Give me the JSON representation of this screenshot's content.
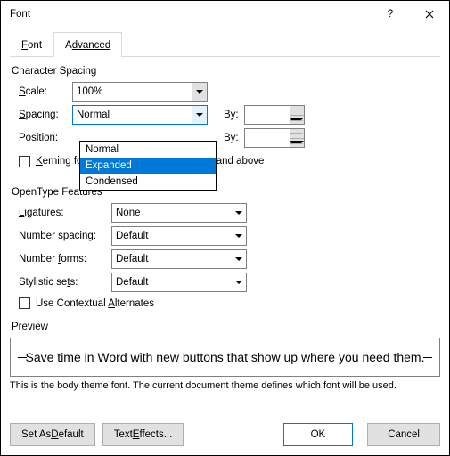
{
  "window": {
    "title": "Font"
  },
  "tabs": {
    "font": "Font",
    "font_u": "F",
    "advanced_prefix": "A",
    "advanced": "dvanced"
  },
  "charSpacing": {
    "title": "Character Spacing",
    "scale_label_pre": "S",
    "scale_label": "cale:",
    "scale_value": "100%",
    "spacing_label_pre": "S",
    "spacing_label": "pacing:",
    "spacing_value": "Normal",
    "spacing_options": [
      "Normal",
      "Expanded",
      "Condensed"
    ],
    "position_label_pre": "P",
    "position_label": "osition:",
    "by1": "By:",
    "by2": "By:",
    "kerning_pre": "K",
    "kerning": "erning for fonts:",
    "points_above": "Points and above"
  },
  "opentype": {
    "title": "OpenType Features",
    "ligatures_label_pre": "L",
    "ligatures_label": "igatures:",
    "ligatures_value": "None",
    "numspacing_label_pre": "N",
    "numspacing_label": "umber spacing:",
    "numspacing_value": "Default",
    "numforms_label_pre": "Number ",
    "numforms_label": "forms:",
    "numforms_letter": "f",
    "numforms_value": "Default",
    "stylsets_label": "Stylistic se",
    "stylsets_letter": "t",
    "stylsets_suffix": "s:",
    "stylsets_value": "Default",
    "contextual_label": "Use Contextual ",
    "contextual_letter": "A",
    "contextual_suffix": "lternates"
  },
  "preview": {
    "title": "Preview",
    "text": "Save time in Word with new buttons that show up where you need them.",
    "hint": "This is the body theme font. The current document theme defines which font will be used."
  },
  "footer": {
    "set_default_pre": "Set As ",
    "set_default_u": "D",
    "set_default_suf": "efault",
    "text_effects": "Text ",
    "text_effects_u": "E",
    "text_effects_suf": "ffects...",
    "ok": "OK",
    "cancel": "Cancel"
  }
}
